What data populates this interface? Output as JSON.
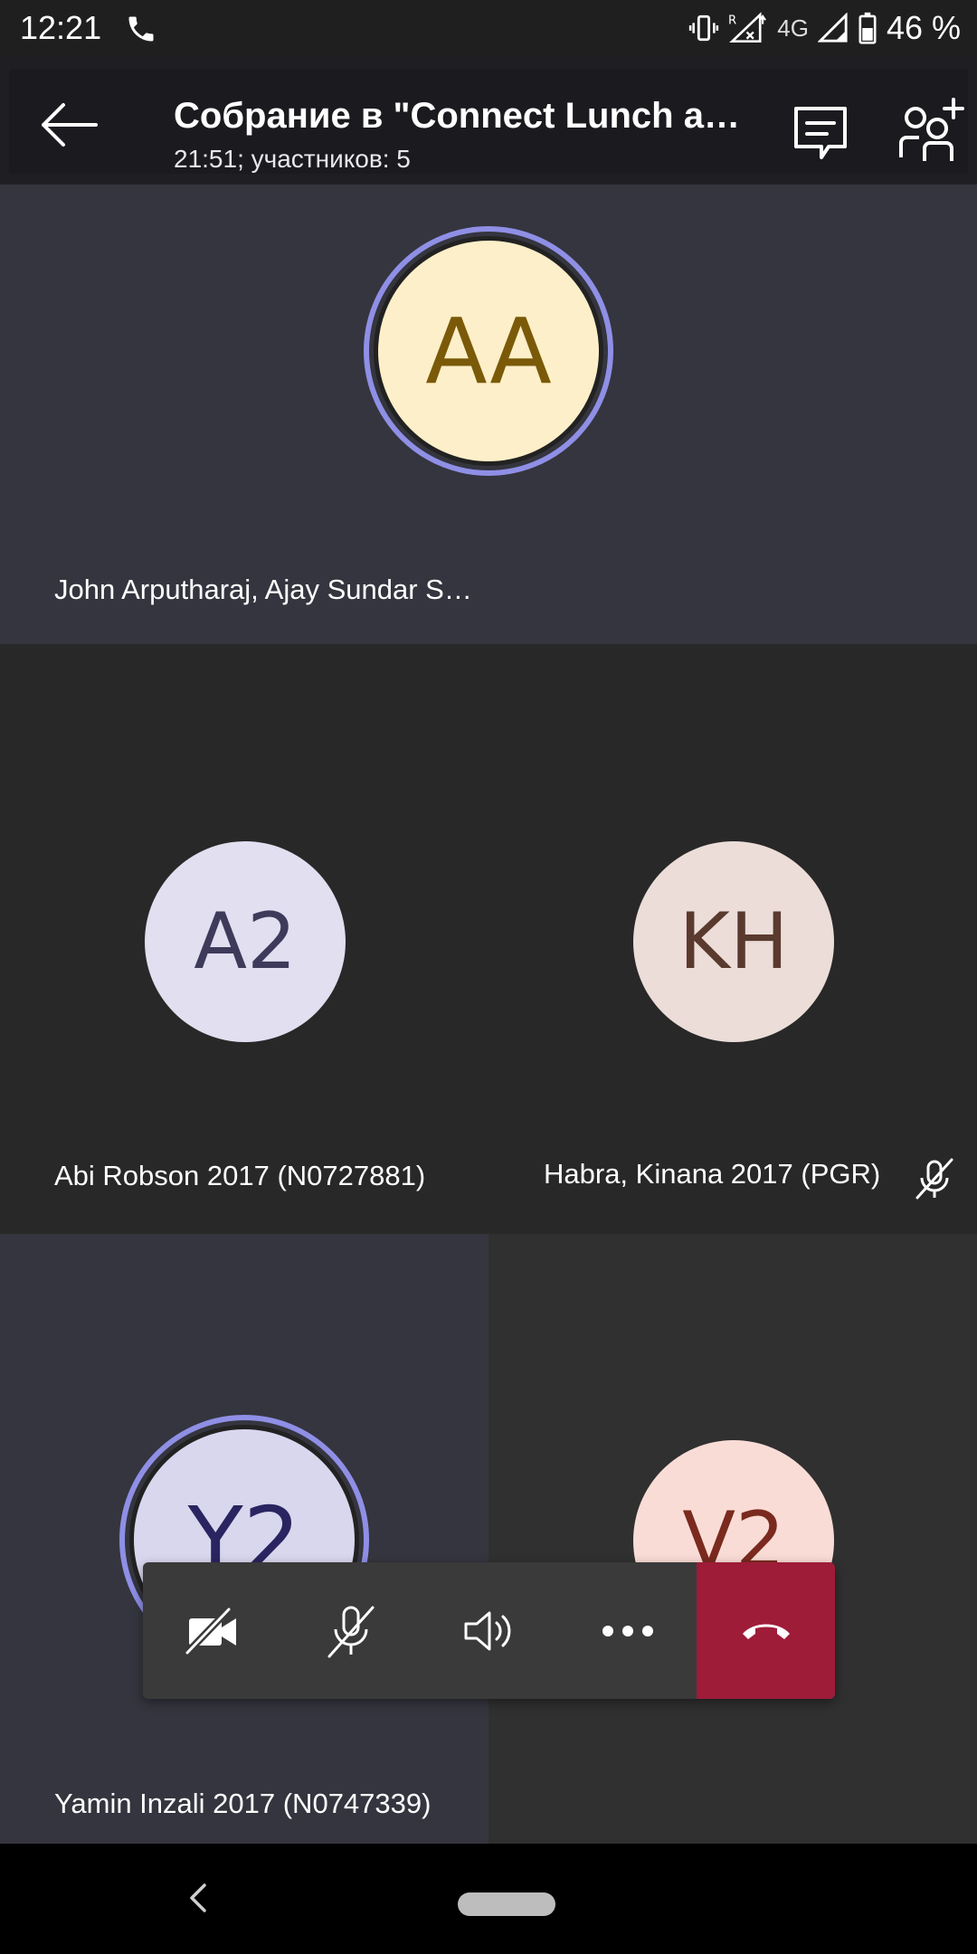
{
  "status_bar": {
    "time": "12:21",
    "network": "4G",
    "battery": "46 %",
    "icons": [
      "phone-icon",
      "vibrate-icon",
      "roaming-signal-icon",
      "signal-icon",
      "battery-icon"
    ]
  },
  "header": {
    "title": "Собрание в \"Connect Lunch and …",
    "subtitle": "21:51; участников: 5",
    "icons": [
      "back-arrow-icon",
      "chat-icon",
      "add-people-icon"
    ]
  },
  "participants": [
    {
      "initials": "AA",
      "name": "John Arputharaj, Ajay Sundar S…",
      "avatar_bg": "#fdefc9",
      "initials_color": "#7a5a08",
      "speaking": true,
      "muted": false
    },
    {
      "initials": "A2",
      "name": "Abi Robson 2017 (N0727881)",
      "avatar_bg": "#e1dff0",
      "initials_color": "#3e3a5a",
      "speaking": false,
      "muted": false
    },
    {
      "initials": "KH",
      "name": "Habra, Kinana 2017 (PGR)",
      "avatar_bg": "#ecddd9",
      "initials_color": "#5a3a2e",
      "speaking": false,
      "muted": true
    },
    {
      "initials": "Y2",
      "name": "Yamin Inzali 2017 (N0747339)",
      "avatar_bg": "#d9d7ee",
      "initials_color": "#2a2460",
      "speaking": true,
      "muted": false
    },
    {
      "initials": "V2",
      "name": "",
      "avatar_bg": "#fadcd6",
      "initials_color": "#7a2a1e",
      "speaking": false,
      "muted": false
    }
  ],
  "controls": [
    {
      "name": "camera-off-button",
      "icon": "camera-off-icon"
    },
    {
      "name": "mic-off-button",
      "icon": "mic-off-icon"
    },
    {
      "name": "speaker-button",
      "icon": "speaker-icon"
    },
    {
      "name": "more-button",
      "icon": "more-icon"
    },
    {
      "name": "hang-up-button",
      "icon": "hang-up-icon"
    }
  ],
  "colors": {
    "speaking_ring": "#8f8fe6",
    "hangup": "#9e1c38"
  }
}
